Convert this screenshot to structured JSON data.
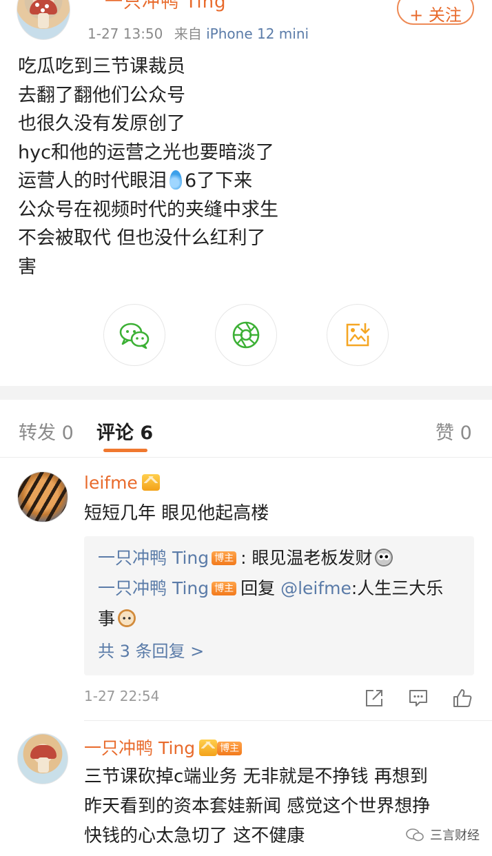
{
  "post": {
    "username": "一只冲鸭 Ting",
    "time": "1-27 13:50",
    "source_prefix": "来自",
    "source": "iPhone 12 mini",
    "follow_label": "+ 关注",
    "lines": [
      "吃瓜吃到三节课裁员",
      "去翻了翻他们公众号",
      "也很久没有发原创了",
      "hyc和他的运营之光也要暗淡了",
      "运营人的时代眼泪",
      "6了下来",
      "公众号在视频时代的夹缝中求生",
      "不会被取代 但也没什么红利了",
      "害"
    ]
  },
  "share": {
    "wechat_icon": "wechat-icon",
    "moments_icon": "moments-icon",
    "image_icon": "save-image-icon"
  },
  "tabs": {
    "repost": "转发 0",
    "comments": "评论 6",
    "likes": "赞 0"
  },
  "comments": [
    {
      "username": "leifme",
      "text": "短短几年 眼见他起高楼",
      "replies": [
        {
          "user": "一只冲鸭 Ting",
          "badge": "博主",
          "text": ": 眼见温老板发财"
        },
        {
          "user": "一只冲鸭 Ting",
          "badge": "博主",
          "prefix": "回复 ",
          "mention": "@leifme",
          "text_line1": ":人生三大乐",
          "text_line2": "事"
        }
      ],
      "more": "共 3 条回复 >",
      "time": "1-27 22:54"
    },
    {
      "username": "一只冲鸭 Ting",
      "badge": "博主",
      "lines": [
        "三节课砍掉c端业务 无非就是不挣钱 再想到",
        "昨天看到的资本套娃新闻 感觉这个世界想挣",
        "快钱的心太急切了 这不健康"
      ]
    }
  ],
  "watermark": "三言财经",
  "colors": {
    "accent": "#e86a2b",
    "link": "#5a7ba8",
    "wechat_green": "#3cb035",
    "image_orange": "#f5a623"
  }
}
